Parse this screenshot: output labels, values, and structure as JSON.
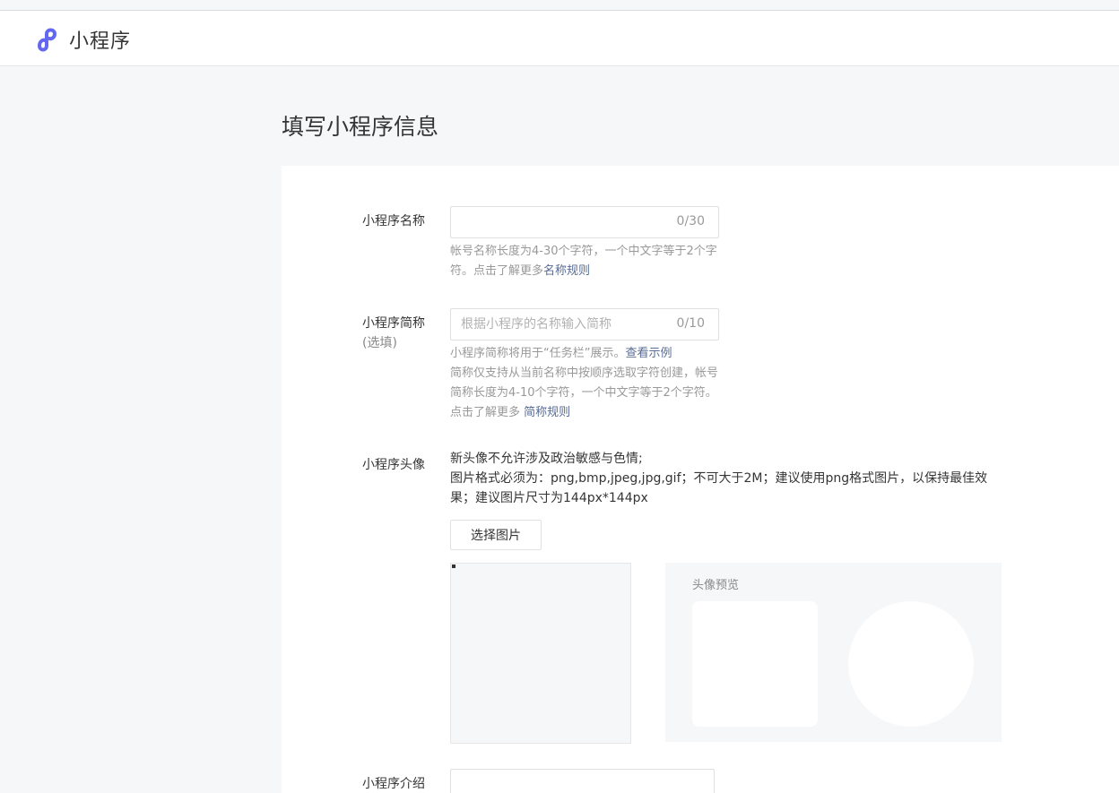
{
  "header": {
    "logo_text": "小程序",
    "logo_icon": "mini-program-link-icon",
    "accent_color": "#6467f0"
  },
  "page": {
    "title": "填写小程序信息"
  },
  "form": {
    "name": {
      "label": "小程序名称",
      "value": "",
      "placeholder": "",
      "counter": "0/30",
      "tip_text": "帐号名称长度为4-30个字符，一个中文字等于2个字符。点击了解更多",
      "tip_link": "名称规则"
    },
    "short_name": {
      "label": "小程序简称",
      "label_sub": "(选填)",
      "value": "",
      "placeholder": "根据小程序的名称输入简称",
      "counter": "0/10",
      "tip_line1_text": "小程序简称将用于“任务栏”展示。",
      "tip_line1_link": "查看示例",
      "tip_text": "简称仅支持从当前名称中按顺序选取字符创建，帐号简称长度为4-10个字符，一个中文字等于2个字符。点击了解更多 ",
      "tip_link": "简称规则"
    },
    "avatar": {
      "label": "小程序头像",
      "desc_line1": "新头像不允许涉及政治敏感与色情;",
      "desc_line2": "图片格式必须为：png,bmp,jpeg,jpg,gif；不可大于2M；建议使用png格式图片，以保持最佳效果；建议图片尺寸为144px*144px",
      "select_button": "选择图片",
      "preview_title": "头像预览"
    },
    "intro": {
      "label": "小程序介绍",
      "value": ""
    }
  }
}
